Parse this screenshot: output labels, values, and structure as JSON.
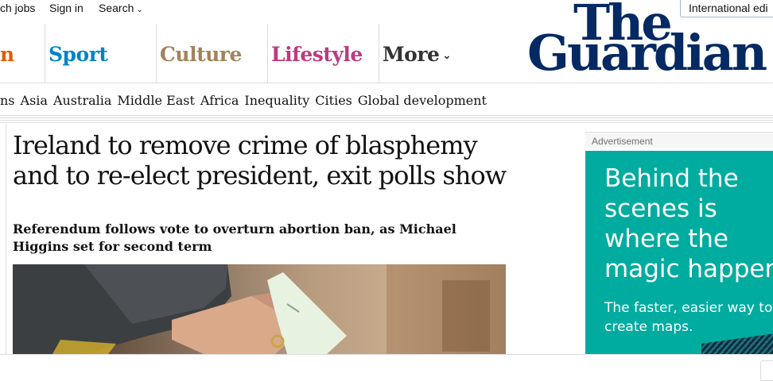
{
  "utility": {
    "jobs": "ch jobs",
    "signin": "Sign in",
    "search": "Search",
    "edition": "International edi"
  },
  "logo": {
    "line1": "The",
    "line2": "Guardian"
  },
  "pillars": [
    {
      "label": "n",
      "color": "#e05e00"
    },
    {
      "label": "Sport",
      "color": "#0084c6"
    },
    {
      "label": "Culture",
      "color": "#a1845c"
    },
    {
      "label": "Lifestyle",
      "color": "#bb3b80"
    },
    {
      "label": "More",
      "color": "#333333"
    }
  ],
  "subnav": [
    "ns",
    "Asia",
    "Australia",
    "Middle East",
    "Africa",
    "Inequality",
    "Cities",
    "Global development"
  ],
  "article": {
    "headline": "Ireland to remove crime of blasphemy and to re-elect president, exit polls show",
    "standfirst": "Referendum follows vote to overturn abortion ban, as Michael Higgins set for second term"
  },
  "ad": {
    "label": "Advertisement",
    "title": "Behind the\nscenes is\nwhere the\nmagic happen",
    "subtitle": "The faster, easier way to create maps.",
    "background": "#00aca0"
  }
}
